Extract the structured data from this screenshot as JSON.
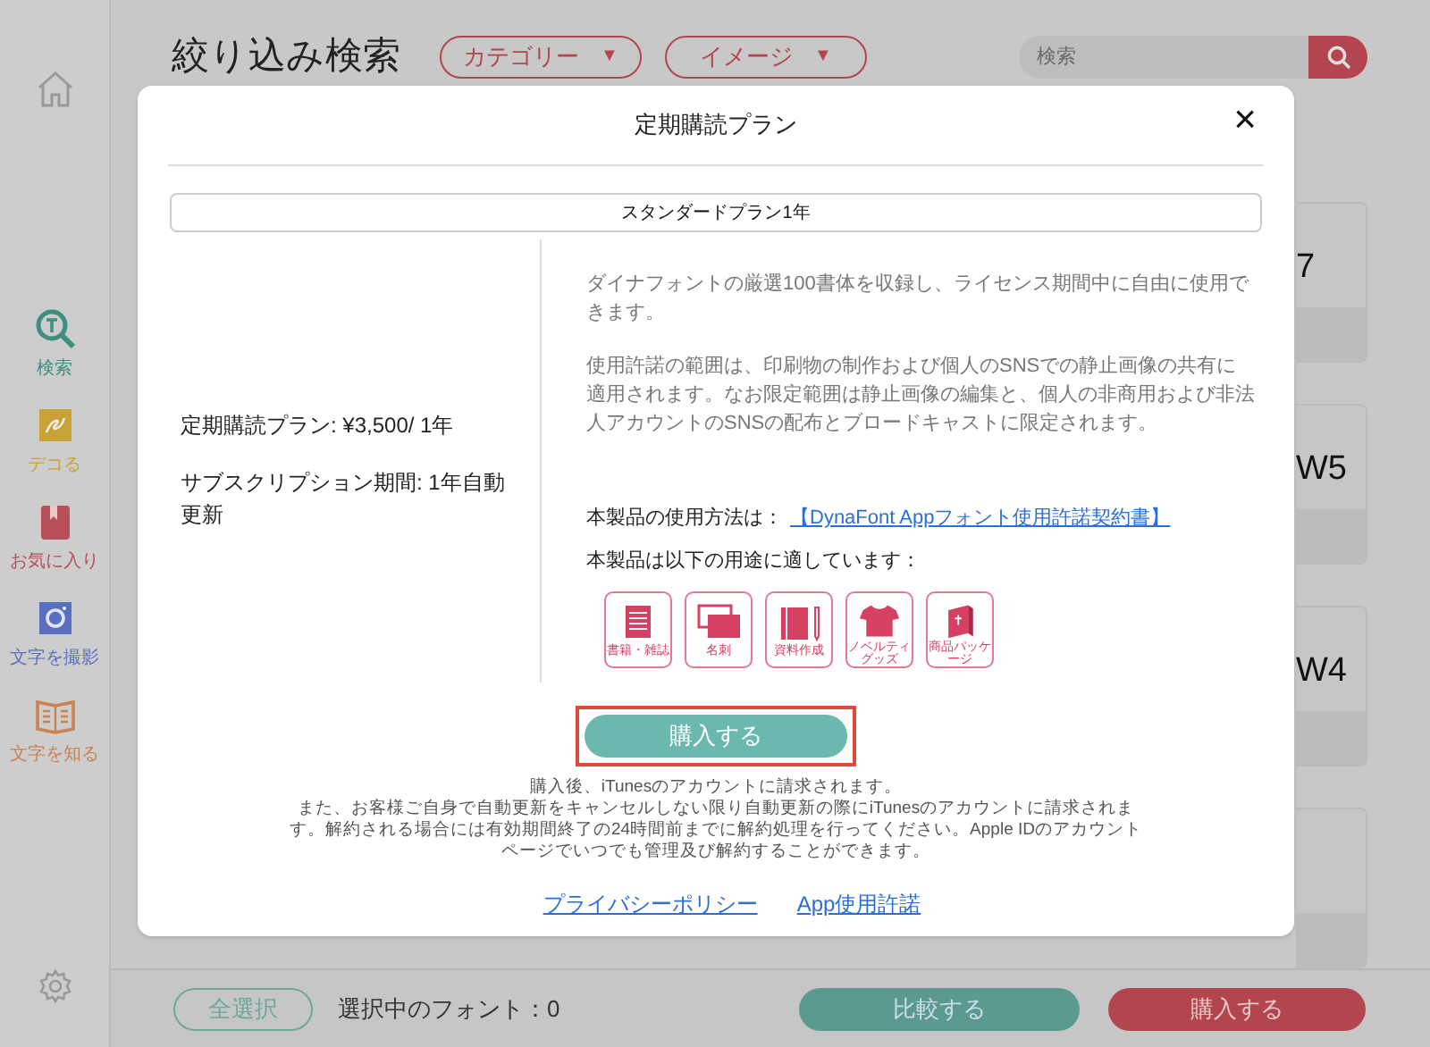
{
  "sidebar": {
    "items": [
      {
        "kind": "search",
        "label": "検索",
        "color": "#3f8f80"
      },
      {
        "kind": "deco",
        "label": "デコる",
        "color": "#c9a235"
      },
      {
        "kind": "favorite",
        "label": "お気に入り",
        "color": "#b8505a"
      },
      {
        "kind": "camera",
        "label": "文字を撮影",
        "color": "#5a6fc0"
      },
      {
        "kind": "learn",
        "label": "文字を知る",
        "color": "#c98250"
      }
    ]
  },
  "header": {
    "title": "絞り込み検索",
    "dropdowns": [
      {
        "label": "カテゴリー",
        "caret": "▼"
      },
      {
        "label": "イメージ",
        "caret": "▼"
      }
    ],
    "search": {
      "placeholder": "検索"
    }
  },
  "cards": [
    {
      "kind": "font",
      "label": "7"
    },
    {
      "kind": "font",
      "label": "W5"
    },
    {
      "kind": "font",
      "label": "W4"
    },
    {
      "kind": "font"
    }
  ],
  "bottom_bar": {
    "select_all": "全選択",
    "selected_count": "選択中のフォント：0",
    "compare": "比較する",
    "buy": "購入する"
  },
  "dialog": {
    "title": "定期購読プラン",
    "close": "×",
    "plans": [
      {
        "label": "スタンダードプラン1年",
        "selected": true
      }
    ],
    "price": "定期購読プラン: ¥3,500/ 1年",
    "period": "サブスクリプション期間: 1年自動更新",
    "description": [
      "ダイナフォントの厳選100書体を収録し、ライセンス期間中に自由に使用できます。",
      "使用許諾の範囲は、印刷物の制作および個人のSNSでの静止画像の共有に適用されます。なお限定範囲は静止画像の編集と、個人の非商用および非法人アカウントのSNSの配布とブロードキャストに限定されます。"
    ],
    "usage_label": "本製品の使用方法は：",
    "usage_link": "【DynaFont Appフォント使用許諾契約書】",
    "suitable_label": "本製品は以下の用途に適しています：",
    "uses": [
      {
        "kind": "book",
        "label": "書籍・雑誌"
      },
      {
        "kind": "card",
        "label": "名刺"
      },
      {
        "kind": "document",
        "label": "資料作成"
      },
      {
        "kind": "shirt",
        "label": "ノベルティグッズ"
      },
      {
        "kind": "package",
        "label": "商品パッケージ"
      }
    ],
    "buy_button": {
      "label": "購入する",
      "highlighted": true
    },
    "notes": [
      "購入後、iTunesのアカウントに請求されます。",
      "また、お客様ご自身で自動更新をキャンセルしない限り自動更新の際にiTunesのアカウントに請求されます。解約される場合には有効期間終了の24時間前までに解約処理を行ってください。Apple IDのアカウントページでいつでも管理及び解約することができます。"
    ],
    "links": [
      "プライバシーポリシー",
      "App使用許諾"
    ]
  }
}
